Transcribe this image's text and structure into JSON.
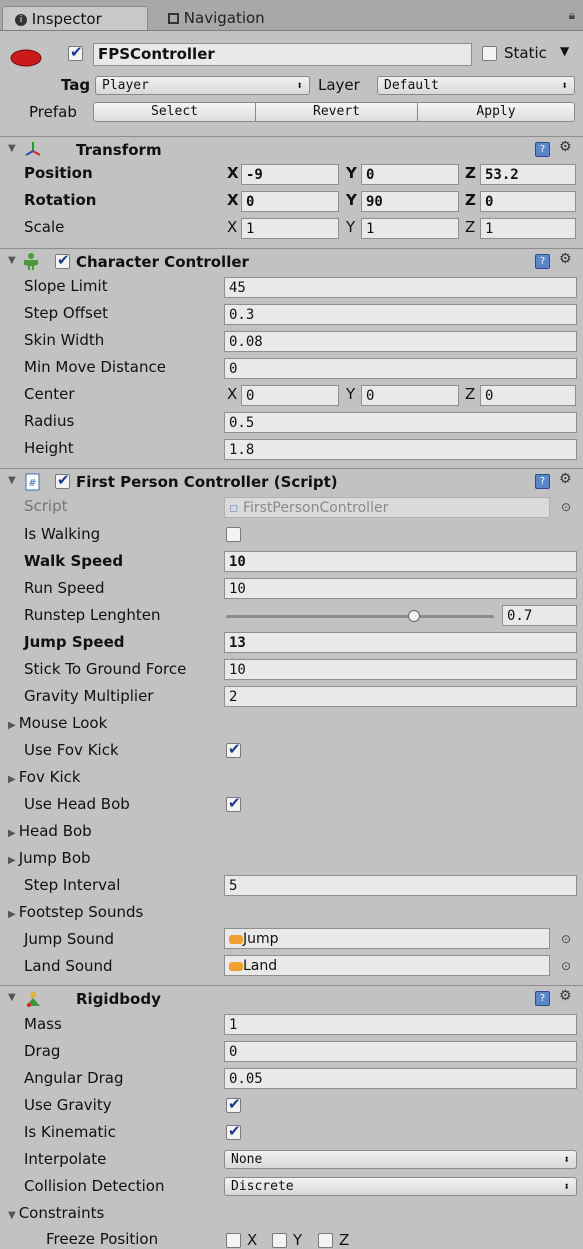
{
  "tabs": [
    {
      "label": "Inspector",
      "icon": "info-icon"
    },
    {
      "label": "Navigation",
      "icon": "navmesh-icon"
    }
  ],
  "gameobject": {
    "active": true,
    "name": "FPSController",
    "static_label": "Static",
    "static_checked": false,
    "tag_label": "Tag",
    "tag_value": "Player",
    "layer_label": "Layer",
    "layer_value": "Default",
    "prefab_label": "Prefab",
    "prefab_buttons": [
      "Select",
      "Revert",
      "Apply"
    ]
  },
  "transform": {
    "title": "Transform",
    "position": {
      "label": "Position",
      "x": "-9",
      "y": "0",
      "z": "53.2"
    },
    "rotation": {
      "label": "Rotation",
      "x": "0",
      "y": "90",
      "z": "0"
    },
    "scale": {
      "label": "Scale",
      "x": "1",
      "y": "1",
      "z": "1"
    }
  },
  "character_controller": {
    "title": "Character Controller",
    "enabled": true,
    "fields": [
      {
        "label": "Slope Limit",
        "value": "45"
      },
      {
        "label": "Step Offset",
        "value": "0.3"
      },
      {
        "label": "Skin Width",
        "value": "0.08"
      },
      {
        "label": "Min Move Distance",
        "value": "0"
      }
    ],
    "center": {
      "label": "Center",
      "x": "0",
      "y": "0",
      "z": "0"
    },
    "radius": {
      "label": "Radius",
      "value": "0.5"
    },
    "height": {
      "label": "Height",
      "value": "1.8"
    }
  },
  "fps_script": {
    "title": "First Person Controller (Script)",
    "enabled": true,
    "script_label": "Script",
    "script_value": "FirstPersonController",
    "is_walking_label": "Is Walking",
    "is_walking": false,
    "walk_speed": {
      "label": "Walk Speed",
      "value": "10"
    },
    "run_speed": {
      "label": "Run Speed",
      "value": "10"
    },
    "runstep": {
      "label": "Runstep Lenghten",
      "value": "0.7",
      "fraction": 0.7
    },
    "jump_speed": {
      "label": "Jump Speed",
      "value": "13"
    },
    "stick_force": {
      "label": "Stick To Ground Force",
      "value": "10"
    },
    "gravity_multiplier": {
      "label": "Gravity Multiplier",
      "value": "2"
    },
    "mouse_look": "Mouse Look",
    "use_fov_kick": {
      "label": "Use Fov Kick",
      "checked": true
    },
    "fov_kick": "Fov Kick",
    "use_head_bob": {
      "label": "Use Head Bob",
      "checked": true
    },
    "head_bob": "Head Bob",
    "jump_bob": "Jump Bob",
    "step_interval": {
      "label": "Step Interval",
      "value": "5"
    },
    "footstep_sounds": "Footstep Sounds",
    "jump_sound": {
      "label": "Jump Sound",
      "value": "Jump"
    },
    "land_sound": {
      "label": "Land Sound",
      "value": "Land"
    }
  },
  "rigidbody": {
    "title": "Rigidbody",
    "mass": {
      "label": "Mass",
      "value": "1"
    },
    "drag": {
      "label": "Drag",
      "value": "0"
    },
    "angular_drag": {
      "label": "Angular Drag",
      "value": "0.05"
    },
    "use_gravity": {
      "label": "Use Gravity",
      "checked": true
    },
    "is_kinematic": {
      "label": "Is Kinematic",
      "checked": true
    },
    "interpolate": {
      "label": "Interpolate",
      "value": "None"
    },
    "collision": {
      "label": "Collision Detection",
      "value": "Discrete"
    },
    "constraints": "Constraints",
    "freeze_position": {
      "label": "Freeze Position",
      "x": "X",
      "y": "Y",
      "z": "Z"
    }
  },
  "colors": {
    "panel": "#c2c2c2",
    "field": "#e9e9e9",
    "accent": "#1a3b8c",
    "gameobject_icon": "#cc1a1a"
  }
}
